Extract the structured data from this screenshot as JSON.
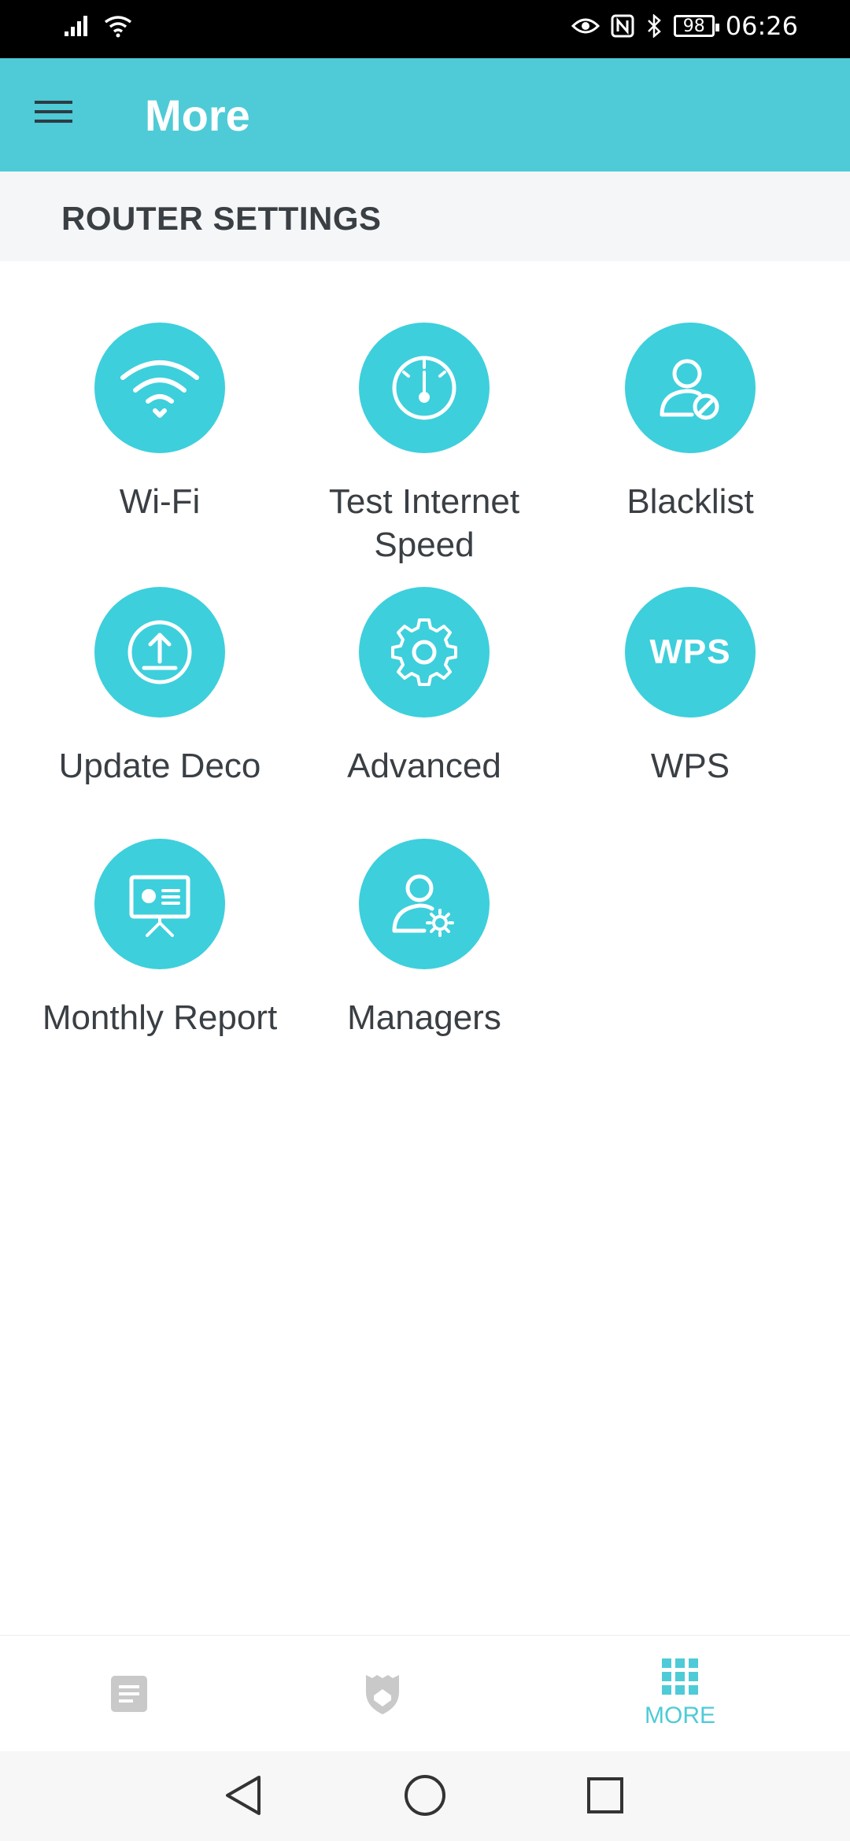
{
  "status_bar": {
    "battery": "98",
    "time": "06:26"
  },
  "app_bar": {
    "title": "More"
  },
  "section": {
    "title": "ROUTER SETTINGS"
  },
  "tiles": [
    {
      "label": "Wi-Fi",
      "icon": "wifi-icon"
    },
    {
      "label": "Test Internet Speed",
      "icon": "speedometer-icon"
    },
    {
      "label": "Blacklist",
      "icon": "user-block-icon"
    },
    {
      "label": "Update Deco",
      "icon": "upload-icon"
    },
    {
      "label": "Advanced",
      "icon": "gear-icon"
    },
    {
      "label": "WPS",
      "icon": "wps-icon",
      "icon_text": "WPS"
    },
    {
      "label": "Monthly Report",
      "icon": "presentation-board-icon"
    },
    {
      "label": "Managers",
      "icon": "user-gear-icon"
    }
  ],
  "bottom_nav": {
    "items": [
      {
        "icon": "document-icon",
        "label": ""
      },
      {
        "icon": "shield-icon",
        "label": ""
      },
      {
        "icon": "grid-icon",
        "label": "MORE",
        "active": true
      }
    ]
  },
  "colors": {
    "accent": "#4ecbd6",
    "tile": "#3dcfdc",
    "text": "#3a3f44"
  }
}
